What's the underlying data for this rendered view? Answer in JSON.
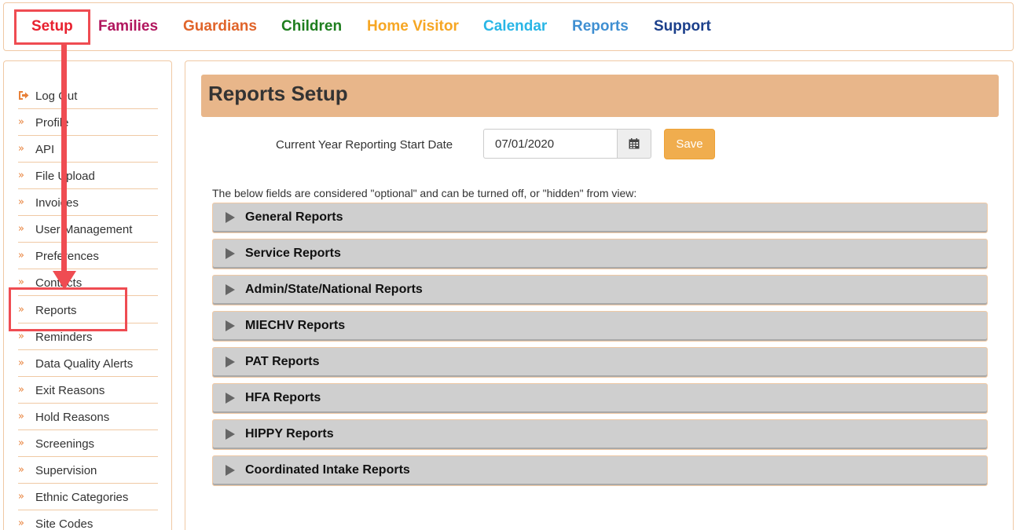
{
  "topnav": {
    "items": [
      {
        "label": "Setup",
        "color": "#e8212f"
      },
      {
        "label": "Families",
        "color": "#b1165e"
      },
      {
        "label": "Guardians",
        "color": "#e0642a"
      },
      {
        "label": "Children",
        "color": "#1e7e1e"
      },
      {
        "label": "Home Visitor",
        "color": "#f6a623"
      },
      {
        "label": "Calendar",
        "color": "#29b6e6"
      },
      {
        "label": "Reports",
        "color": "#3f8fd2"
      },
      {
        "label": "Support",
        "color": "#1b3f8b"
      }
    ]
  },
  "sidebar": {
    "items": [
      {
        "label": "Log Out",
        "icon": "logout-icon"
      },
      {
        "label": "Profile",
        "icon": "chevron-double-right-icon"
      },
      {
        "label": "API",
        "icon": "chevron-double-right-icon"
      },
      {
        "label": "File Upload",
        "icon": "chevron-double-right-icon"
      },
      {
        "label": "Invoices",
        "icon": "chevron-double-right-icon"
      },
      {
        "label": "User Management",
        "icon": "chevron-double-right-icon"
      },
      {
        "label": "Preferences",
        "icon": "chevron-double-right-icon"
      },
      {
        "label": "Contacts",
        "icon": "chevron-double-right-icon"
      },
      {
        "label": "Reports",
        "icon": "chevron-double-right-icon"
      },
      {
        "label": "Reminders",
        "icon": "chevron-double-right-icon"
      },
      {
        "label": "Data Quality Alerts",
        "icon": "chevron-double-right-icon"
      },
      {
        "label": "Exit Reasons",
        "icon": "chevron-double-right-icon"
      },
      {
        "label": "Hold Reasons",
        "icon": "chevron-double-right-icon"
      },
      {
        "label": "Screenings",
        "icon": "chevron-double-right-icon"
      },
      {
        "label": "Supervision",
        "icon": "chevron-double-right-icon"
      },
      {
        "label": "Ethnic Categories",
        "icon": "chevron-double-right-icon"
      },
      {
        "label": "Site Codes",
        "icon": "chevron-double-right-icon"
      }
    ]
  },
  "main": {
    "title": "Reports Setup",
    "date_label": "Current Year Reporting Start Date",
    "date_value": "07/01/2020",
    "save_label": "Save",
    "info_text": "The below fields are considered \"optional\" and can be turned off, or \"hidden\" from view:",
    "sections": [
      {
        "label": "General Reports"
      },
      {
        "label": "Service Reports"
      },
      {
        "label": "Admin/State/National Reports"
      },
      {
        "label": "MIECHV Reports"
      },
      {
        "label": "PAT Reports"
      },
      {
        "label": "HFA Reports"
      },
      {
        "label": "HIPPY Reports"
      },
      {
        "label": "Coordinated Intake Reports"
      }
    ]
  },
  "colors": {
    "accent_border": "#f0c9a4",
    "title_bg": "#e8b68a",
    "save_bg": "#f0ad4e",
    "highlight": "#ef4c52",
    "chevron": "#e8813a"
  }
}
